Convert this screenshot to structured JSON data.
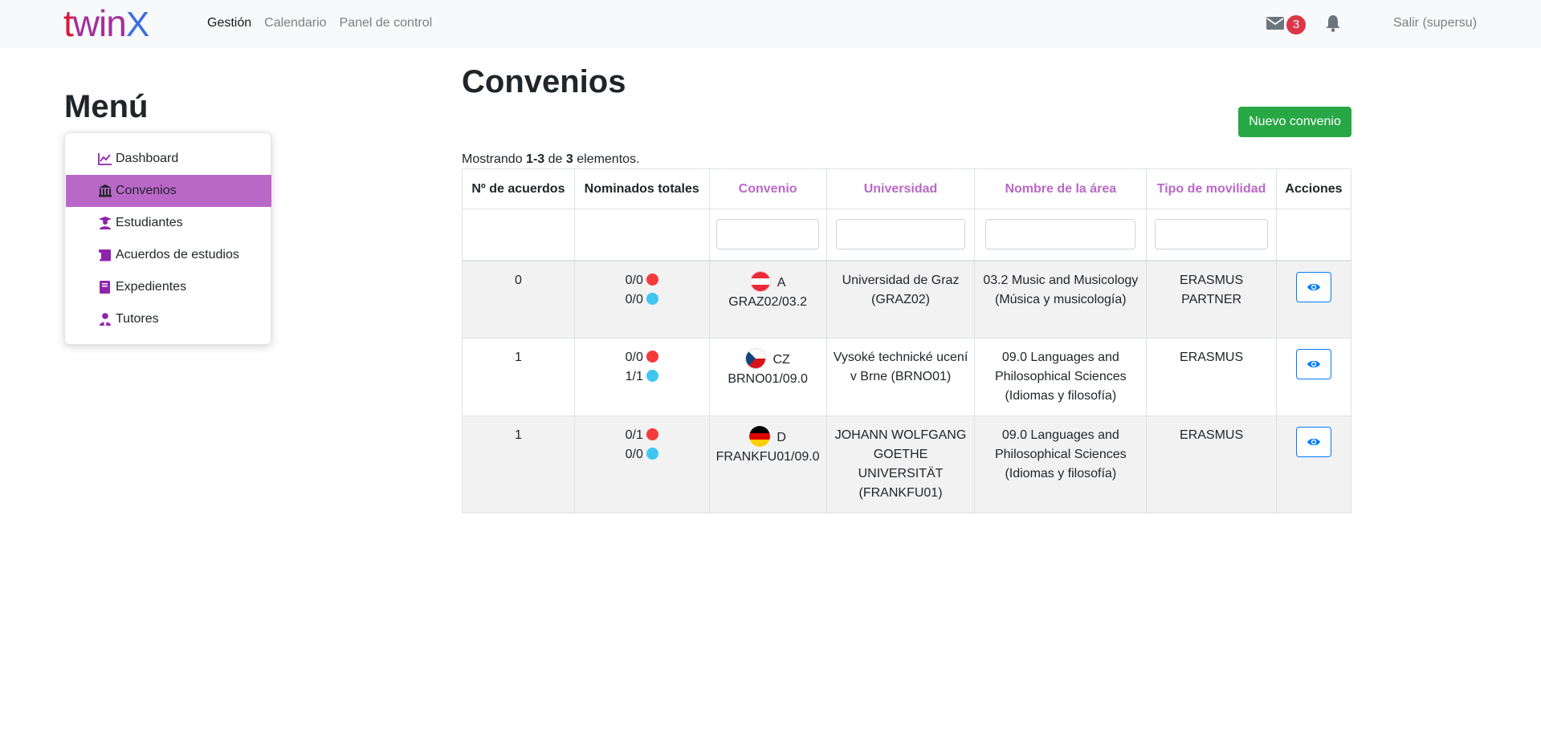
{
  "app": {
    "brand_part1": "t",
    "brand_part2": "win",
    "brand_part3": "X"
  },
  "nav": {
    "links": [
      "Gestión",
      "Calendario",
      "Panel de control"
    ],
    "active": "Gestión",
    "mail_count": "3",
    "logout": "Salir (supersu)"
  },
  "sidebar": {
    "title": "Menú",
    "items": [
      {
        "label": "Dashboard",
        "icon": "chart-line-icon"
      },
      {
        "label": "Convenios",
        "icon": "university-icon",
        "active": true
      },
      {
        "label": "Estudiantes",
        "icon": "graduate-icon"
      },
      {
        "label": "Acuerdos de estudios",
        "icon": "scroll-icon"
      },
      {
        "label": "Expedientes",
        "icon": "book-icon"
      },
      {
        "label": "Tutores",
        "icon": "user-tie-icon"
      }
    ]
  },
  "main": {
    "title": "Convenios",
    "new_button": "Nuevo convenio",
    "summary_prefix": "Mostrando ",
    "summary_range": "1-3",
    "summary_mid": " de ",
    "summary_total": "3",
    "summary_suffix": " elementos."
  },
  "table": {
    "headers": [
      "Nº de acuerdos",
      "Nominados totales",
      "Convenio",
      "Universidad",
      "Nombre de la área",
      "Tipo de movilidad",
      "Acciones"
    ],
    "rows": [
      {
        "acuerdos": "0",
        "nominados_red": "0/0",
        "nominados_blue": "0/0",
        "flag": "austria",
        "country": "A",
        "convenio": "GRAZ02/03.2",
        "universidad": "Universidad de Graz (GRAZ02)",
        "area": "03.2 Music and Musicology (Música y musicología)",
        "movilidad": "ERASMUS PARTNER"
      },
      {
        "acuerdos": "1",
        "nominados_red": "0/0",
        "nominados_blue": "1/1",
        "flag": "czech",
        "country": "CZ",
        "convenio": "BRNO01/09.0",
        "universidad": "Vysoké technické ucení v Brne (BRNO01)",
        "area": "09.0 Languages and Philosophical Sciences (Idiomas y filosofía)",
        "movilidad": "ERASMUS"
      },
      {
        "acuerdos": "1",
        "nominados_red": "0/1",
        "nominados_blue": "0/0",
        "flag": "germany",
        "country": "D",
        "convenio": "FRANKFU01/09.0",
        "universidad": "JOHANN WOLFGANG GOETHE UNIVERSITÄT (FRANKFU01)",
        "area": "09.0 Languages and Philosophical Sciences (Idiomas y filosofía)",
        "movilidad": "ERASMUS"
      }
    ]
  },
  "colors": {
    "accent": "#ba68c8",
    "success": "#28a745",
    "primary": "#007bff",
    "danger": "#dc3545",
    "dot_red": "#f43b3b",
    "dot_blue": "#3ec6f0"
  }
}
